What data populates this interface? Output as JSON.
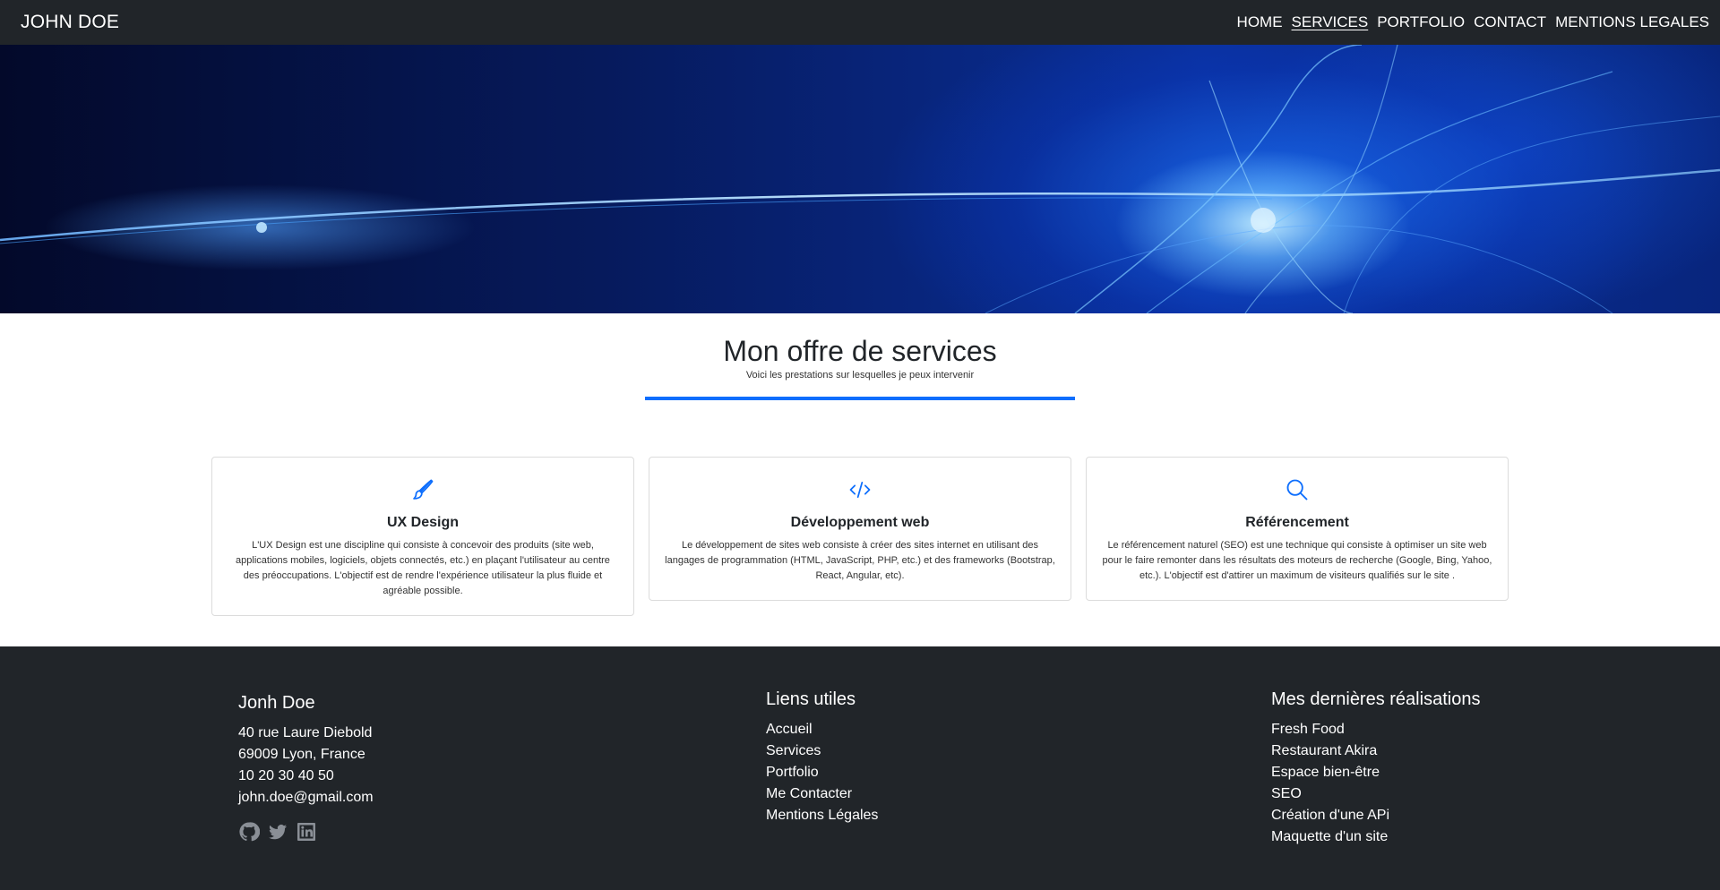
{
  "navbar": {
    "brand": "JOHN DOE",
    "links": [
      {
        "label": "HOME"
      },
      {
        "label": "SERVICES"
      },
      {
        "label": "PORTFOLIO"
      },
      {
        "label": "CONTACT"
      },
      {
        "label": "MENTIONS LEGALES"
      }
    ],
    "active": "SERVICES"
  },
  "services": {
    "title": "Mon offre de services",
    "subtitle": "Voici les prestations sur lesquelles je peux intervenir",
    "accent_color": "#0d6efd",
    "cards": [
      {
        "icon": "brush-icon",
        "title": "UX Design",
        "text": "L'UX Design est une discipline qui consiste à concevoir des produits (site web, applications mobiles, logiciels, objets connectés, etc.) en plaçant l'utilisateur au centre des préoccupations. L'objectif est de rendre l'expérience utilisateur la plus fluide et agréable possible."
      },
      {
        "icon": "code-icon",
        "title": "Développement web",
        "text": "Le développement de sites web consiste à créer des sites internet en utilisant des langages de programmation (HTML, JavaScript, PHP, etc.) et des frameworks (Bootstrap, React, Angular, etc)."
      },
      {
        "icon": "search-icon",
        "title": "Référencement",
        "text": "Le référencement naturel (SEO) est une technique qui consiste à optimiser un site web pour le faire remonter dans les résultats des moteurs de recherche (Google, Bing, Yahoo, etc.). L'objectif est d'attirer un maximum de visiteurs qualifiés sur le site ."
      }
    ]
  },
  "footer": {
    "contact": {
      "name": "Jonh Doe",
      "address": "40 rue Laure Diebold",
      "city": "69009 Lyon, France",
      "phone": "10 20 30 40 50",
      "email": "john.doe@gmail.com",
      "socials": [
        "github-icon",
        "twitter-icon",
        "linkedin-icon"
      ]
    },
    "links": {
      "title": "Liens utiles",
      "items": [
        "Accueil",
        "Services",
        "Portfolio",
        "Me Contacter",
        "Mentions Légales"
      ]
    },
    "works": {
      "title": "Mes dernières réalisations",
      "items": [
        "Fresh Food",
        "Restaurant Akira",
        "Espace bien-être",
        "SEO",
        "Création d'une APi",
        "Maquette d'un site"
      ]
    }
  }
}
